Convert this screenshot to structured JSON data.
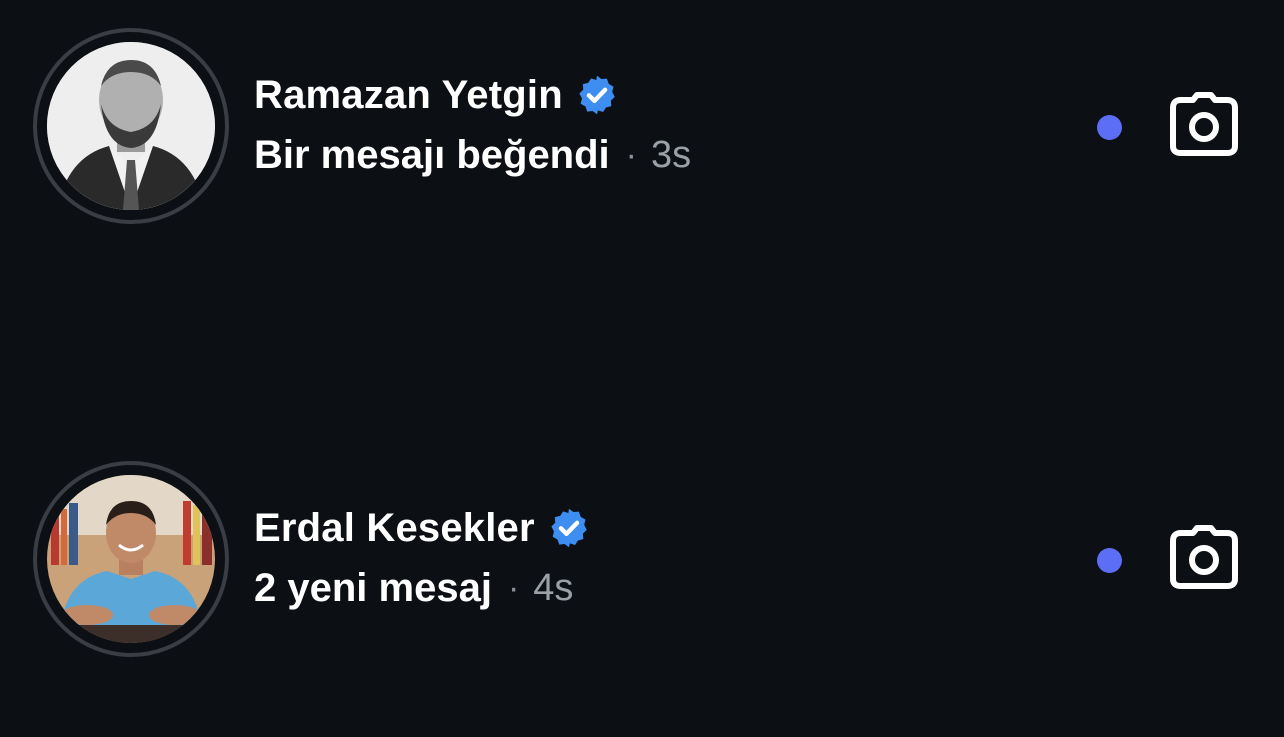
{
  "threads": [
    {
      "name": "Ramazan Yetgin",
      "verified": true,
      "preview": "Bir mesajı beğendi",
      "separator": "·",
      "time": "3s",
      "unread": true,
      "avatar_icon": "avatar-photo",
      "action_icon": "camera-icon"
    },
    {
      "name": "Erdal Kesekler",
      "verified": true,
      "preview": "2 yeni mesaj",
      "separator": "·",
      "time": "4s",
      "unread": true,
      "avatar_icon": "avatar-photo",
      "action_icon": "camera-icon"
    }
  ],
  "colors": {
    "background": "#0c0f14",
    "verified_badge": "#3d8ef0",
    "unread_dot": "#5b6ef5",
    "time_text": "#9a9fa8"
  }
}
